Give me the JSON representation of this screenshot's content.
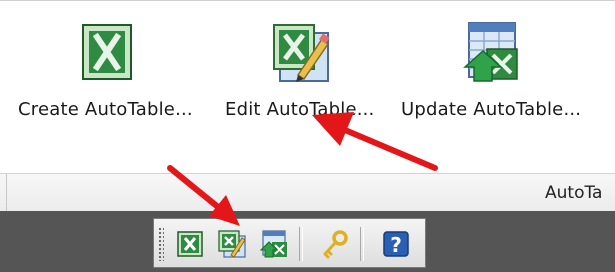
{
  "ribbon": {
    "buttons": [
      {
        "label": "Create AutoTable...",
        "icon": "excel-create-icon"
      },
      {
        "label": "Edit AutoTable...",
        "icon": "excel-edit-icon"
      },
      {
        "label": "Update AutoTable...",
        "icon": "excel-update-icon"
      }
    ],
    "group_title": "AutoTa"
  },
  "toolbar": {
    "buttons": [
      {
        "icon": "excel-create-icon"
      },
      {
        "icon": "excel-edit-icon"
      },
      {
        "icon": "excel-update-icon"
      },
      {
        "icon": "key-icon"
      },
      {
        "icon": "help-icon"
      }
    ]
  },
  "colors": {
    "excel_green": "#1e7b34",
    "arrow_red": "#e3161a",
    "taskbar": "#555555",
    "help_blue": "#2b5fb4",
    "key_gold": "#e0b020"
  }
}
